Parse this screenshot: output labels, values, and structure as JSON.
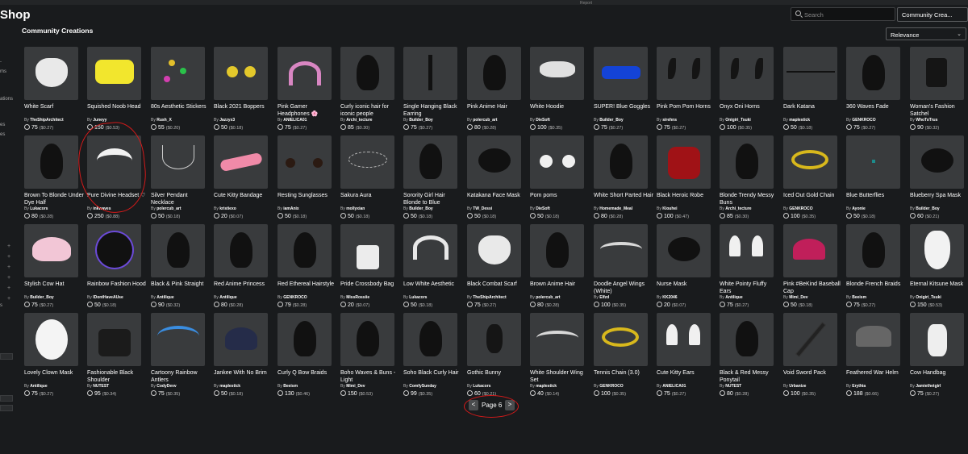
{
  "header": {
    "title": "Shop",
    "report": "Report",
    "section": "Community Creations",
    "search_placeholder": "Search",
    "category": "Community Crea...",
    "sort": "Relevance"
  },
  "leftnav": {
    "labels": [
      "ms",
      "ations",
      "es",
      "es",
      "s"
    ]
  },
  "pager": {
    "label": "Page 6",
    "prev": "<",
    "next": ">"
  },
  "colors": {
    "bg": "#191b1d",
    "card": "#393b3d",
    "accent": "#d41a1a"
  },
  "items": [
    {
      "name": "White Scarf",
      "creator": "TheShipArchitect",
      "price": "75",
      "usd": "($0.27)",
      "icon": "scarf-icon"
    },
    {
      "name": "Squished Noob Head",
      "creator": "Juneyy",
      "price": "150",
      "usd": "($0.53)",
      "icon": "noob-head-icon"
    },
    {
      "name": "80s Aesthetic Stickers",
      "creator": "Rush_X",
      "price": "55",
      "usd": "($0.20)",
      "icon": "stickers-icon"
    },
    {
      "name": "Black 2021 Boppers",
      "creator": "Jazzyx3",
      "price": "50",
      "usd": "($0.18)",
      "icon": "boppers-icon"
    },
    {
      "name": "Pink Gamer Headphones 🌸",
      "creator": "ANIELICA01",
      "price": "75",
      "usd": "($0.27)",
      "icon": "headphones-icon"
    },
    {
      "name": "Curly iconic hair for iconic people",
      "creator": "Archi_tecture",
      "price": "85",
      "usd": "($0.30)",
      "icon": "hair-icon"
    },
    {
      "name": "Single Hanging Black Earring",
      "creator": "Builder_Boy",
      "price": "75",
      "usd": "($0.27)",
      "icon": "earring-icon"
    },
    {
      "name": "Pink Anime Hair",
      "creator": "polercub_art",
      "price": "80",
      "usd": "($0.28)",
      "icon": "hair-icon"
    },
    {
      "name": "White Hoodie",
      "creator": "DieSoft",
      "price": "100",
      "usd": "($0.35)",
      "icon": "hoodie-icon"
    },
    {
      "name": "SUPER! Blue Goggles",
      "creator": "Builder_Boy",
      "price": "75",
      "usd": "($0.27)",
      "icon": "goggles-icon"
    },
    {
      "name": "Pink Pom Pom Horns",
      "creator": "sirehns",
      "price": "75",
      "usd": "($0.27)",
      "icon": "horns-icon"
    },
    {
      "name": "Onyx Oni Horns",
      "creator": "Onigiri_Tsuki",
      "price": "100",
      "usd": "($0.35)",
      "icon": "horns-icon"
    },
    {
      "name": "Dark Katana",
      "creator": "maplestick",
      "price": "50",
      "usd": "($0.18)",
      "icon": "katana-icon"
    },
    {
      "name": "360 Waves Fade",
      "creator": "GENKROCO",
      "price": "75",
      "usd": "($0.27)",
      "icon": "hair-icon"
    },
    {
      "name": "Woman's Fashion Satchel",
      "creator": "WhoToTrus",
      "price": "90",
      "usd": "($0.32)",
      "icon": "satchel-icon"
    },
    {
      "name": "Brown To Blonde Under Dye Half",
      "creator": "Lukacors",
      "price": "80",
      "usd": "($0.28)",
      "icon": "hair-icon"
    },
    {
      "name": "Pure Divine Headset ♡",
      "creator": "inkwaves",
      "price": "250",
      "usd": "($0.88)",
      "icon": "wings-headset-icon"
    },
    {
      "name": "Silver Pendant Necklace",
      "creator": "polercub_art",
      "price": "50",
      "usd": "($0.18)",
      "icon": "necklace-icon"
    },
    {
      "name": "Cute Kitty Bandage",
      "creator": "kristiexo",
      "price": "20",
      "usd": "($0.07)",
      "icon": "bandage-icon"
    },
    {
      "name": "Resting Sunglasses",
      "creator": "iamAnix",
      "price": "50",
      "usd": "($0.18)",
      "icon": "sunglasses-icon"
    },
    {
      "name": "Sakura Aura",
      "creator": "mollyxian",
      "price": "50",
      "usd": "($0.18)",
      "icon": "aura-icon"
    },
    {
      "name": "Sorority Girl Hair Blonde to Blue",
      "creator": "Builder_Boy",
      "price": "50",
      "usd": "($0.18)",
      "icon": "hair-icon"
    },
    {
      "name": "Katakana Face Mask",
      "creator": "TW_Dessi",
      "price": "50",
      "usd": "($0.18)",
      "icon": "mask-icon"
    },
    {
      "name": "Pom poms",
      "creator": "DieSoft",
      "price": "50",
      "usd": "($0.18)",
      "icon": "pompoms-icon"
    },
    {
      "name": "White Short Parted Hair",
      "creator": "Homemade_Meal",
      "price": "80",
      "usd": "($0.28)",
      "icon": "hair-icon"
    },
    {
      "name": "Black Heroic Robe",
      "creator": "Kiouhei",
      "price": "100",
      "usd": "($0.47)",
      "icon": "robe-icon"
    },
    {
      "name": "Blonde Trendy Messy Buns",
      "creator": "Archi_tecture",
      "price": "85",
      "usd": "($0.30)",
      "icon": "hair-icon"
    },
    {
      "name": "Iced Out Gold Chain",
      "creator": "GENKROCO",
      "price": "100",
      "usd": "($0.35)",
      "icon": "chain-icon"
    },
    {
      "name": "Blue Butterflies",
      "creator": "Ayonie",
      "price": "50",
      "usd": "($0.18)",
      "icon": "butterflies-icon"
    },
    {
      "name": "Blueberry Spa Mask",
      "creator": "Builder_Boy",
      "price": "60",
      "usd": "($0.21)",
      "icon": "mask-icon"
    },
    {
      "name": "Stylish Cow Hat",
      "creator": "Builder_Boy",
      "price": "75",
      "usd": "($0.27)",
      "icon": "hat-icon"
    },
    {
      "name": "Rainbow Fashion Hood",
      "creator": "IDontHaveAUse",
      "price": "50",
      "usd": "($0.18)",
      "icon": "hood-icon"
    },
    {
      "name": "Black & Pink Straight",
      "creator": "Antilique",
      "price": "90",
      "usd": "($0.32)",
      "icon": "hair-icon"
    },
    {
      "name": "Red Anime Princess",
      "creator": "Antilique",
      "price": "80",
      "usd": "($0.28)",
      "icon": "hair-icon"
    },
    {
      "name": "Red Ethereal Hairstyle",
      "creator": "GENKROCO",
      "price": "79",
      "usd": "($0.28)",
      "icon": "hair-icon"
    },
    {
      "name": "Pride Crossbody Bag",
      "creator": "MissRossiie",
      "price": "20",
      "usd": "($0.07)",
      "icon": "bag-icon"
    },
    {
      "name": "Low White Aesthetic",
      "creator": "Lukacors",
      "price": "50",
      "usd": "($0.18)",
      "icon": "headband-icon"
    },
    {
      "name": "Black Combat Scarf",
      "creator": "TheShipArchitect",
      "price": "75",
      "usd": "($0.27)",
      "icon": "scarf-icon"
    },
    {
      "name": "Brown Anime Hair",
      "creator": "polercub_art",
      "price": "80",
      "usd": "($0.28)",
      "icon": "hair-icon"
    },
    {
      "name": "Doodle Angel Wings (White)",
      "creator": "Elfzd",
      "price": "100",
      "usd": "($0.35)",
      "icon": "wings-icon"
    },
    {
      "name": "Nurse Mask",
      "creator": "KK2046",
      "price": "20",
      "usd": "($0.07)",
      "icon": "mask-icon"
    },
    {
      "name": "White Pointy Fluffy Ears",
      "creator": "Antilique",
      "price": "75",
      "usd": "($0.27)",
      "icon": "ears-icon"
    },
    {
      "name": "Pink #BeKind Baseball Cap",
      "creator": "Mimi_Dev",
      "price": "50",
      "usd": "($0.18)",
      "icon": "cap-icon"
    },
    {
      "name": "Blonde French Braids",
      "creator": "Beeism",
      "price": "75",
      "usd": "($0.27)",
      "icon": "hair-icon"
    },
    {
      "name": "Eternal Kitsune Mask",
      "creator": "Onigiri_Tsuki",
      "price": "150",
      "usd": "($0.53)",
      "icon": "kitsune-mask-icon"
    },
    {
      "name": "Lovely Clown Mask",
      "creator": "Antilique",
      "price": "75",
      "usd": "($0.27)",
      "icon": "clown-mask-icon"
    },
    {
      "name": "Fashionable Black Shoulder",
      "creator": "NUTEST",
      "price": "95",
      "usd": "($0.34)",
      "icon": "shoulder-bag-icon"
    },
    {
      "name": "Cartoony Rainbow Antlers",
      "creator": "CodyDevv",
      "price": "75",
      "usd": "($0.35)",
      "icon": "antlers-icon"
    },
    {
      "name": "Jankee With No Brim",
      "creator": "maplestick",
      "price": "50",
      "usd": "($0.18)",
      "icon": "beanie-icon"
    },
    {
      "name": "Curly Q Bow Braids",
      "creator": "Beeism",
      "price": "130",
      "usd": "($0.46)",
      "icon": "hair-icon"
    },
    {
      "name": "Boho Waves & Buns - Light",
      "creator": "Mimi_Dev",
      "price": "150",
      "usd": "($0.53)",
      "icon": "hair-icon"
    },
    {
      "name": "Soho Black Curly Hair",
      "creator": "ComfySunday",
      "price": "99",
      "usd": "($0.35)",
      "icon": "hair-icon"
    },
    {
      "name": "Gothic Bunny",
      "creator": "Lukacors",
      "price": "60",
      "usd": "($0.21)",
      "icon": "bunny-icon"
    },
    {
      "name": "White Shoulder Wing Set",
      "creator": "maplestick",
      "price": "40",
      "usd": "($0.14)",
      "icon": "wings-icon"
    },
    {
      "name": "Tennis Chain (3.0)",
      "creator": "GENKROCO",
      "price": "100",
      "usd": "($0.35)",
      "icon": "chain-icon"
    },
    {
      "name": "Cute Kitty Ears",
      "creator": "ANIELICA01",
      "price": "75",
      "usd": "($0.27)",
      "icon": "ears-icon"
    },
    {
      "name": "Black & Red Messy Ponytail",
      "creator": "NUTEST",
      "price": "80",
      "usd": "($0.28)",
      "icon": "hair-icon"
    },
    {
      "name": "Void Sword Pack",
      "creator": "Urbanize",
      "price": "100",
      "usd": "($0.35)",
      "icon": "swords-icon"
    },
    {
      "name": "Feathered War Helm",
      "creator": "Erythia",
      "price": "188",
      "usd": "($0.66)",
      "icon": "helm-icon"
    },
    {
      "name": "Cow Handbag",
      "creator": "Jamiethetgirl",
      "price": "75",
      "usd": "($0.27)",
      "icon": "handbag-icon"
    }
  ]
}
